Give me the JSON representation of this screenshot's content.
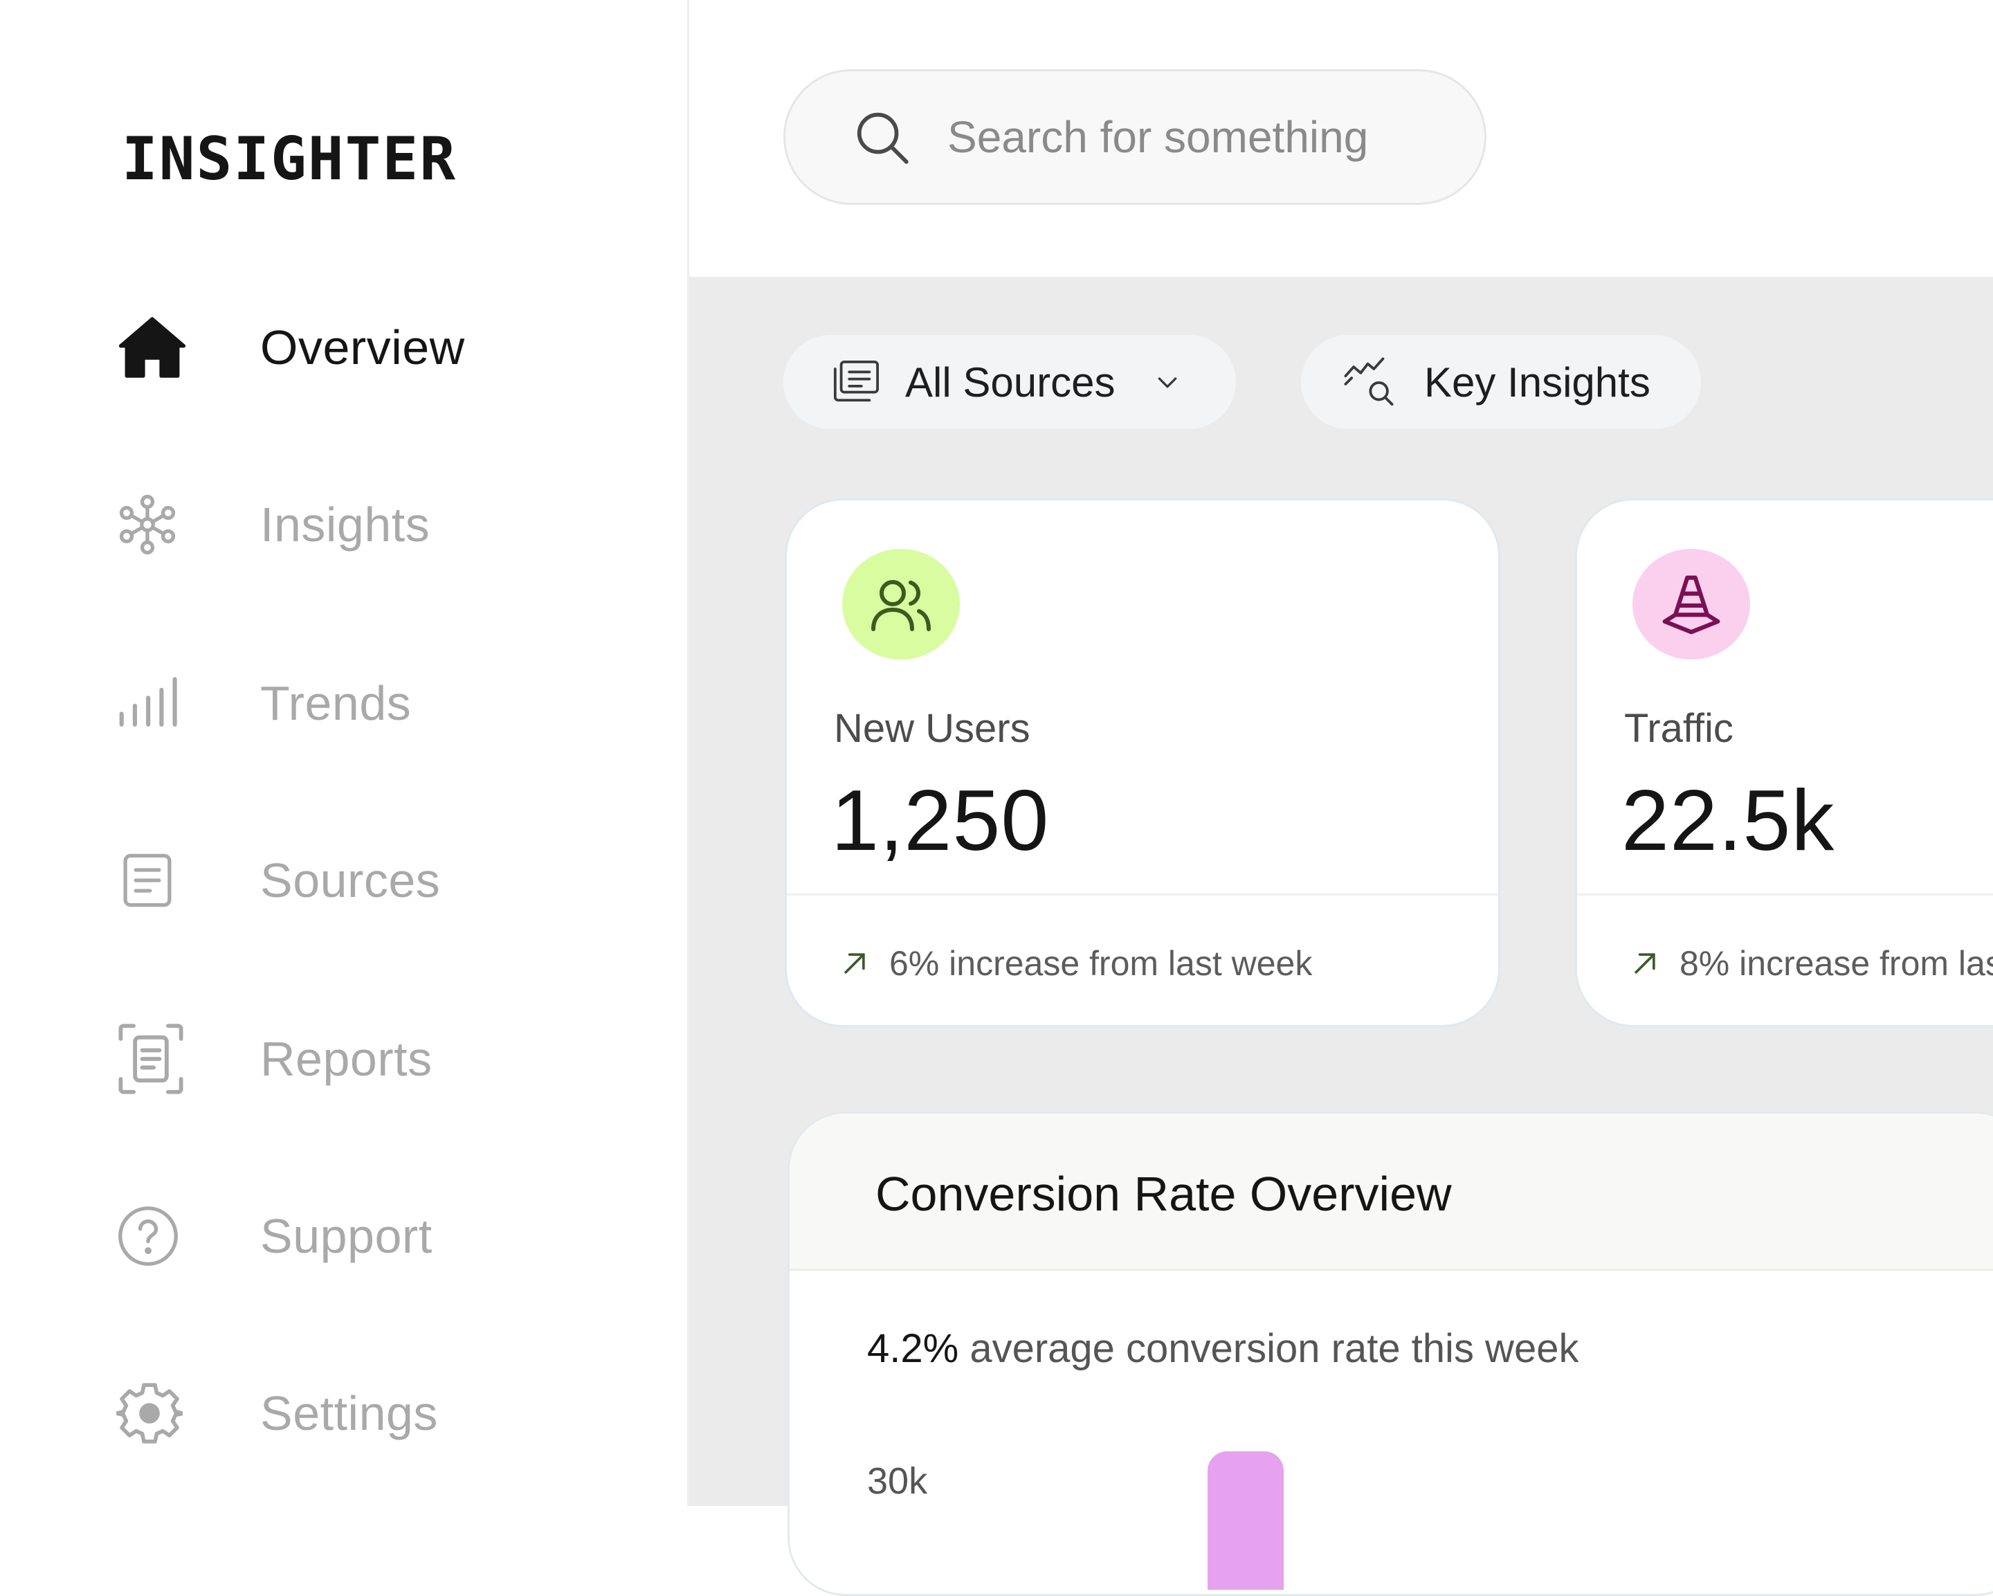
{
  "app": {
    "logo": "INSIGHTER"
  },
  "sidebar": {
    "items": [
      {
        "label": "Overview",
        "icon": "home-icon",
        "active": true
      },
      {
        "label": "Insights",
        "icon": "network-icon",
        "active": false
      },
      {
        "label": "Trends",
        "icon": "bar-signal-icon",
        "active": false
      },
      {
        "label": "Sources",
        "icon": "document-icon",
        "active": false
      },
      {
        "label": "Reports",
        "icon": "report-scan-icon",
        "active": false
      },
      {
        "label": "Support",
        "icon": "question-circle-icon",
        "active": false
      },
      {
        "label": "Settings",
        "icon": "gear-icon",
        "active": false
      }
    ]
  },
  "search": {
    "placeholder": "Search for something"
  },
  "filters": {
    "sources_label": "All Sources",
    "insights_label": "Key Insights"
  },
  "cards": [
    {
      "title": "New Users",
      "value": "1,250",
      "change": "6% increase from last week",
      "icon": "users-icon",
      "icon_bg": "#d9fca0",
      "icon_color": "#3e5a1e"
    },
    {
      "title": "Traffic",
      "value": "22.5k",
      "change": "8% increase from las",
      "icon": "traffic-cone-icon",
      "icon_bg": "#fbd0ee",
      "icon_color": "#7a1054"
    }
  ],
  "conversion": {
    "title": "Conversion Rate Overview",
    "rate": "4.2%",
    "rate_text": " average conversion rate this week",
    "axis_top": "30k",
    "bar_color": "#e6a2ee"
  }
}
